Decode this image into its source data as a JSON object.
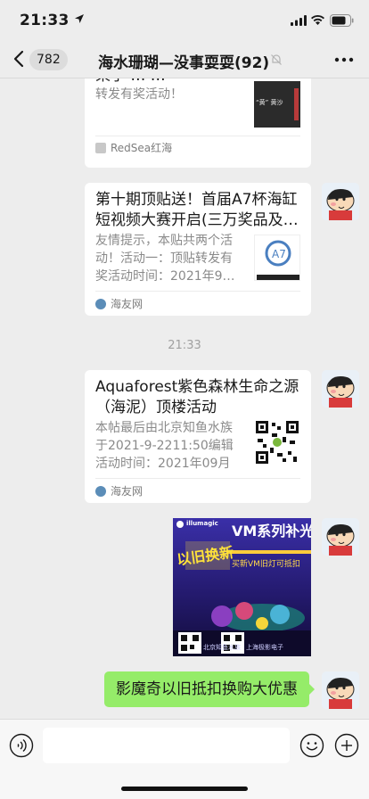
{
  "status_bar": {
    "time": "21:33"
  },
  "nav": {
    "unread_count": "782",
    "title": "海水珊瑚—没事耍耍(92)"
  },
  "messages": {
    "card1": {
      "title_partial": "束了 … …",
      "desc": "转发有奖活动！",
      "source": "RedSea红海",
      "thumb_text": "“黄” 黄沙"
    },
    "card2": {
      "title": "第十期顶贴送！首届A7杯海缸短视频大赛开启(三万奖品及…",
      "desc": "友情提示，本贴共两个活动！活动一：顶贴转发有奖活动时间：2021年9…",
      "source": "海友网"
    },
    "timestamp": "21:33",
    "card3": {
      "title": "Aquaforest紫色森林生命之源（海泥）顶楼活动",
      "desc": "本帖最后由北京知鱼水族于2021-9-2211:50编辑活动时间：2021年09月22…",
      "source": "海友网"
    },
    "poster": {
      "brand": "illumagic",
      "headline": "VM系列补光灯",
      "badge": "以旧换新",
      "subline": "买新VM旧灯可抵扣",
      "footer_left": "北京知鱼水族",
      "footer_right": "上海极影电子"
    },
    "bubble_text": "影魔奇以旧抵扣换购大优惠"
  },
  "colors": {
    "bg": "#ededed",
    "bubble": "#95ec69",
    "card": "#ffffff",
    "muted": "#8a8a8a",
    "source_icon": "#5b8db8"
  },
  "icons": {
    "back": "chevron-left-icon",
    "more": "more-icon",
    "voice": "voice-icon",
    "emoji": "emoji-icon",
    "plus": "plus-icon"
  }
}
